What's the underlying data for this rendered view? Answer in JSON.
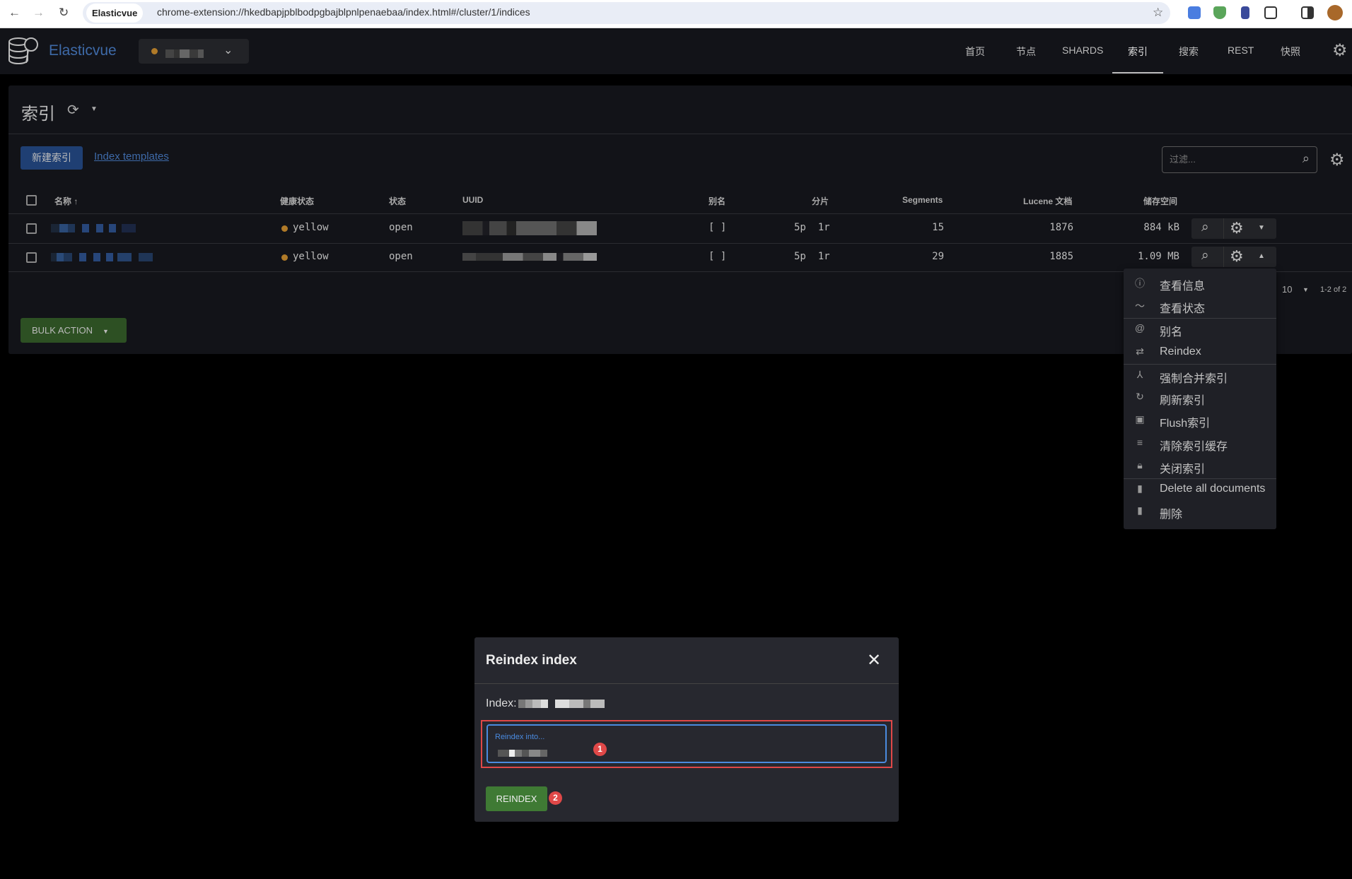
{
  "browser": {
    "tab_title": "Elasticvue",
    "url": "chrome-extension://hkedbapjpblbodpgbajblpnlpenaebaa/index.html#/cluster/1/indices"
  },
  "app": {
    "brand": "Elasticvue",
    "nav": [
      "首页",
      "节点",
      "SHARDS",
      "索引",
      "搜索",
      "REST",
      "快照"
    ],
    "active_nav": "索引",
    "cluster_status_color": "#b07a28"
  },
  "page": {
    "title": "索引",
    "new_index": "新建索引",
    "index_templates": "Index templates",
    "filter_placeholder": "过滤...",
    "bulk_action": "BULK ACTION"
  },
  "table": {
    "headers": {
      "name": "名称 ↑",
      "health": "健康状态",
      "status": "状态",
      "uuid": "UUID",
      "alias": "别名",
      "shards": "分片",
      "segments": "Segments",
      "lucene": "Lucene 文档",
      "storage": "储存空间"
    },
    "rows": [
      {
        "health": "yellow",
        "status": "open",
        "alias": "[ ]",
        "shards": "5p  1r",
        "segments": "15",
        "lucene": "1876",
        "storage": "884 kB"
      },
      {
        "health": "yellow",
        "status": "open",
        "alias": "[ ]",
        "shards": "5p  1r",
        "segments": "29",
        "lucene": "1885",
        "storage": "1.09 MB"
      }
    ],
    "per_page": "10",
    "range": "1-2 of 2"
  },
  "menu": {
    "items": [
      {
        "icon": "info-icon",
        "label": "查看信息"
      },
      {
        "icon": "chart-line-icon",
        "label": "查看状态"
      },
      {
        "icon": "at-icon",
        "label": "别名"
      },
      {
        "icon": "swap-icon",
        "label": "Reindex"
      },
      {
        "icon": "merge-icon",
        "label": "强制合并索引"
      },
      {
        "icon": "refresh-icon",
        "label": "刷新索引"
      },
      {
        "icon": "archive-icon",
        "label": "Flush索引"
      },
      {
        "icon": "clear-icon",
        "label": "清除索引缓存"
      },
      {
        "icon": "lock-icon",
        "label": "关闭索引"
      },
      {
        "icon": "trash-icon",
        "label": "Delete all documents"
      },
      {
        "icon": "trash-icon",
        "label": "删除"
      }
    ]
  },
  "modal": {
    "title": "Reindex index",
    "index_label": "Index:",
    "input_label": "Reindex into...",
    "button": "REINDEX",
    "annotations": [
      "1",
      "2"
    ],
    "annotation_color": "#e04848"
  }
}
